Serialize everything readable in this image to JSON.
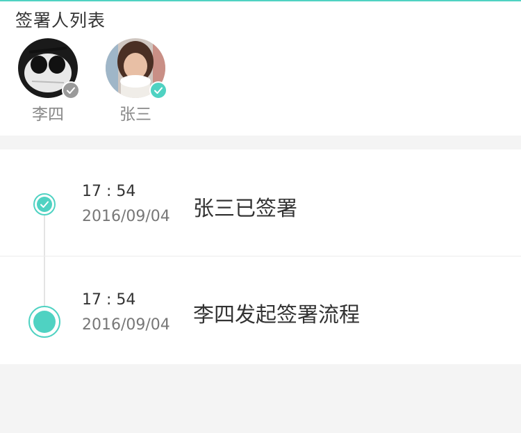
{
  "signers_section": {
    "title": "签署人列表",
    "signers": [
      {
        "name": "李四",
        "status_icon": "check-icon",
        "badge_color": "#9a9a9a"
      },
      {
        "name": "张三",
        "status_icon": "check-icon",
        "badge_color": "#4fd2c2"
      }
    ]
  },
  "timeline": {
    "accent_color": "#4fd2c2",
    "events": [
      {
        "time": "17 : 54",
        "date": "2016/09/04",
        "text": "张三已签署",
        "node": "check-node"
      },
      {
        "time": "17 : 54",
        "date": "2016/09/04",
        "text": "李四发起签署流程",
        "node": "filled-node"
      }
    ]
  }
}
